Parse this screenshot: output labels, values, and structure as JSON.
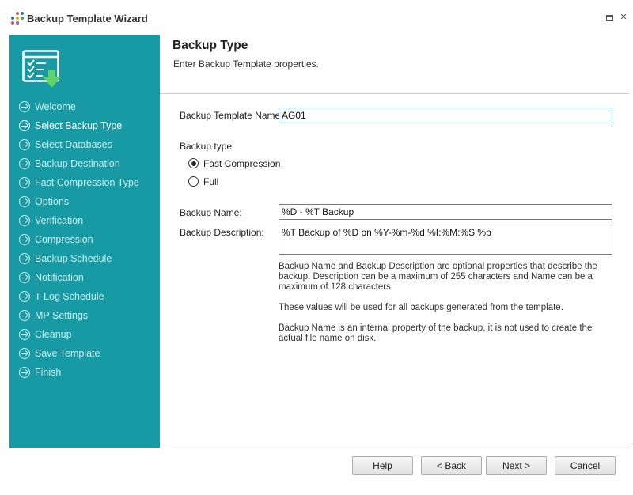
{
  "window": {
    "title": "Backup Template Wizard",
    "close_glyph": "✕",
    "accent": "#179aa3"
  },
  "sidebar": {
    "hero_icon": "checklist-download-icon",
    "items": [
      {
        "label": "Welcome",
        "active": false
      },
      {
        "label": "Select Backup Type",
        "active": true
      },
      {
        "label": "Select Databases",
        "active": false
      },
      {
        "label": "Backup Destination",
        "active": false
      },
      {
        "label": "Fast Compression Type",
        "active": false
      },
      {
        "label": "Options",
        "active": false
      },
      {
        "label": "Verification",
        "active": false
      },
      {
        "label": "Compression",
        "active": false
      },
      {
        "label": "Backup Schedule",
        "active": false
      },
      {
        "label": "Notification",
        "active": false
      },
      {
        "label": "T-Log Schedule",
        "active": false
      },
      {
        "label": "MP Settings",
        "active": false
      },
      {
        "label": "Cleanup",
        "active": false
      },
      {
        "label": "Save Template",
        "active": false
      },
      {
        "label": "Finish",
        "active": false
      }
    ]
  },
  "header": {
    "title": "Backup Type",
    "subtitle": "Enter Backup Template properties."
  },
  "form": {
    "template_name_label": "Backup Template Name:",
    "template_name_value": "AG01",
    "backup_type_label": "Backup type:",
    "options": [
      {
        "label": "Fast Compression",
        "checked": true
      },
      {
        "label": "Full",
        "checked": false
      }
    ],
    "backup_name_label": "Backup Name:",
    "backup_name_value": "%D - %T Backup",
    "backup_desc_label": "Backup Description:",
    "backup_desc_value": "%T Backup of %D on %Y-%m-%d %I:%M:%S %p",
    "info_1": "Backup Name and Backup Description are optional properties that describe the backup. Description can be a maximum of 255 characters and Name can be a maximum of 128 characters.",
    "info_2": "These values will be used for all backups generated from the template.",
    "info_3": "Backup Name is an internal property of the backup, it is not used to create the actual file name on disk."
  },
  "buttons": {
    "help": "Help",
    "back": "< Back",
    "next": "Next >",
    "cancel": "Cancel"
  }
}
